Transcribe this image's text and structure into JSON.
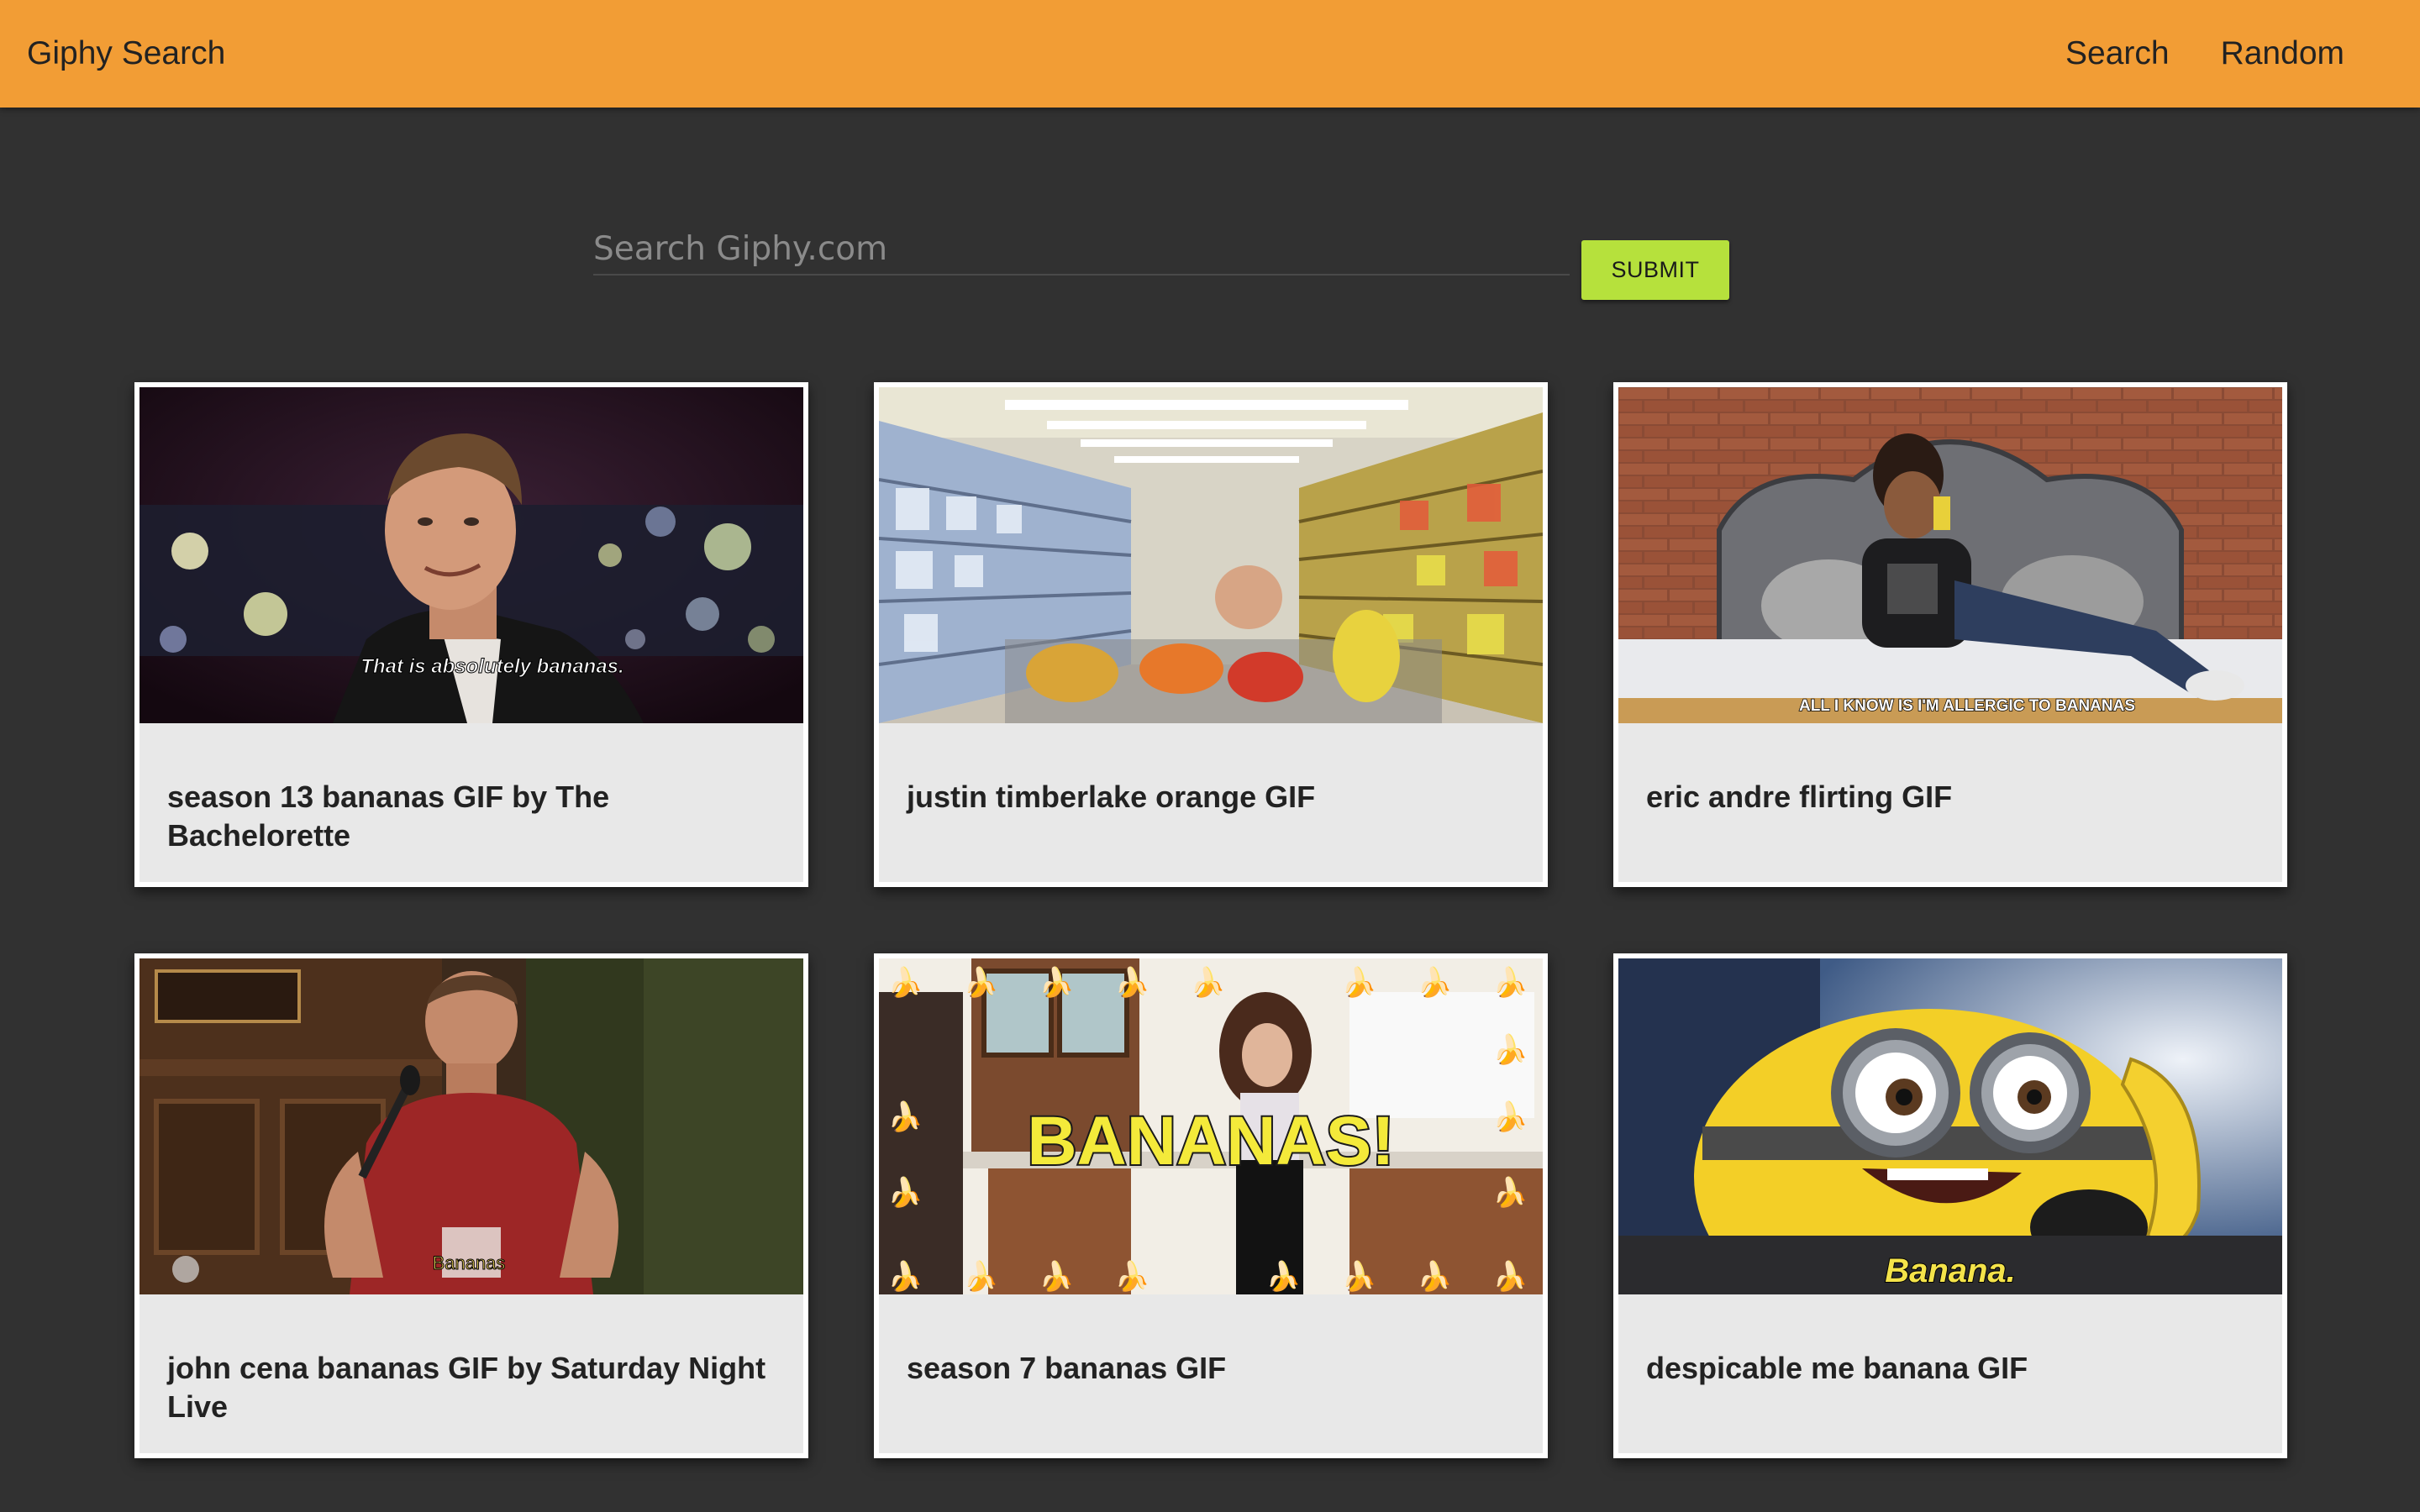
{
  "navbar": {
    "brand": "Giphy Search",
    "links": [
      "Search",
      "Random"
    ],
    "background_color": "#f29d35"
  },
  "search": {
    "placeholder": "Search Giphy.com",
    "value": "",
    "submit_label": "SUBMIT",
    "submit_color": "#b6e13c"
  },
  "results": [
    {
      "title": "season 13 bananas GIF by The Bachelorette",
      "caption": "That is absolutely bananas."
    },
    {
      "title": "justin timberlake orange GIF",
      "caption": ""
    },
    {
      "title": "eric andre flirting GIF",
      "caption": "ALL I KNOW IS I'M ALLERGIC TO BANANAS"
    },
    {
      "title": "john cena bananas GIF by Saturday Night Live",
      "caption": "Bananas"
    },
    {
      "title": "season 7 bananas GIF",
      "caption": "BANANAS!"
    },
    {
      "title": "despicable me banana GIF",
      "caption": "Banana."
    }
  ],
  "colors": {
    "page_background": "#313131",
    "card_background": "#e8e8e8",
    "card_border": "#ffffff"
  }
}
